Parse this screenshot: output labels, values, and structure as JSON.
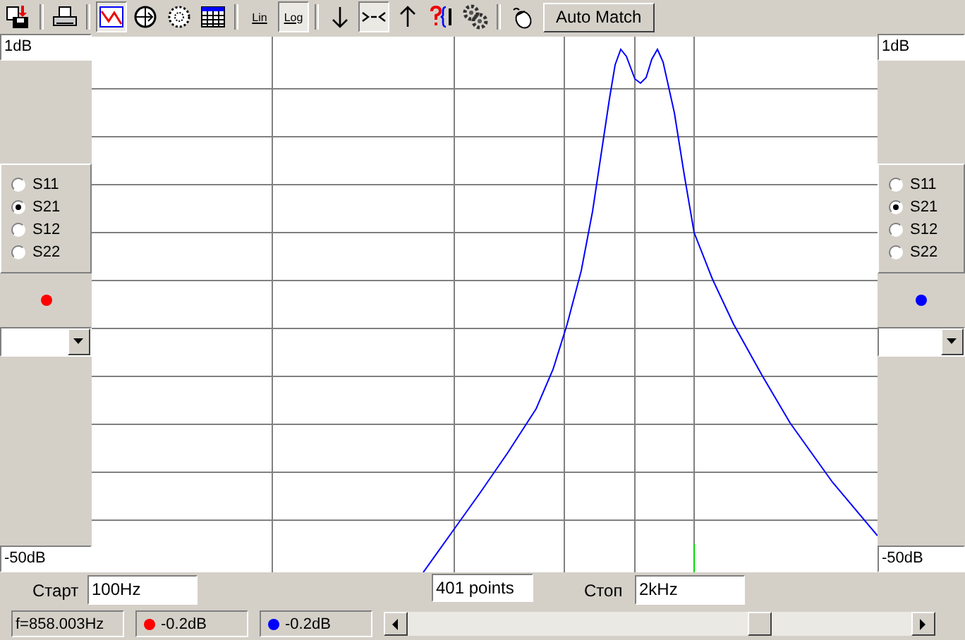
{
  "toolbar": {
    "view_buttons": [
      {
        "selected": true
      },
      {
        "selected": false
      },
      {
        "selected": false
      },
      {
        "selected": false
      }
    ],
    "scale_buttons": [
      {
        "label": "Lin",
        "selected": false
      },
      {
        "label": "Log",
        "selected": true
      }
    ],
    "marker_buttons": [
      {
        "selected": false
      },
      {
        "selected": true
      },
      {
        "selected": false
      }
    ],
    "auto_match": "Auto Match"
  },
  "panels": [
    {
      "top_value": "1dB",
      "params": [
        {
          "label": "S11",
          "selected": false
        },
        {
          "label": "S21",
          "selected": true
        },
        {
          "label": "S12",
          "selected": false
        },
        {
          "label": "S22",
          "selected": false
        }
      ],
      "color": "#ff0000",
      "bottom_value": "-50dB"
    },
    {
      "top_value": "1dB",
      "params": [
        {
          "label": "S11",
          "selected": false
        },
        {
          "label": "S21",
          "selected": true
        },
        {
          "label": "S12",
          "selected": false
        },
        {
          "label": "S22",
          "selected": false
        }
      ],
      "color": "#0000ff",
      "bottom_value": "-50dB"
    }
  ],
  "sweep": {
    "start_label": "Старт",
    "start_value": "100Hz",
    "points": "401 points",
    "stop_label": "Стоп",
    "stop_value": "2kHz"
  },
  "status_bar": {
    "frequency": "f=858.003Hz",
    "readings": [
      {
        "color": "#ff0000",
        "value": "-0.2dB"
      },
      {
        "color": "#0000ff",
        "value": "-0.2dB"
      }
    ]
  }
}
